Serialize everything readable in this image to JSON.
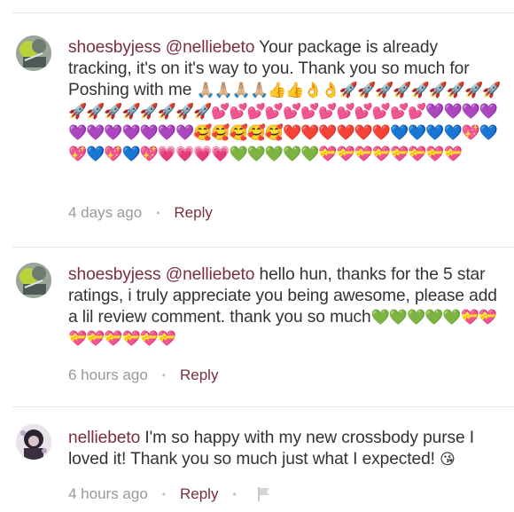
{
  "colors": {
    "username": "#7a2e3e",
    "body_text": "#333333",
    "meta_text": "#999999",
    "divider": "#e6e6e6"
  },
  "comments": [
    {
      "username": "shoesbyjess",
      "mention": "@nelliebeto",
      "text": "Your package is already tracking, it's on it's way to you. Thank you so much for Poshing with me",
      "emojis": "🙏🏼🙏🏼🙏🏼🙏🏼👍👍👌👌🚀🚀🚀🚀🚀🚀🚀🚀🚀🚀🚀🚀🚀🚀🚀🚀🚀💕💕💕💕💕💕💕💕💕💕💕💕💜💜💜💜💜💜💜💜💜💜💜🥰🥰🥰🥰🥰❤️❤️❤️❤️❤️❤️💙💙💙💙💖💙💖💙💖💙💖💗💗💗💗💚💚💚💚💚💝💝💝💝💝💝💝💝",
      "time": "4 days ago",
      "reply_label": "Reply",
      "avatar_icon": "profile-photo-icon"
    },
    {
      "username": "shoesbyjess",
      "mention": "@nelliebeto",
      "text": "hello hun, thanks for the 5 star ratings, i truly appreciate you being awesome, please add a lil review comment. thank you so much",
      "emojis": "💚💚💚💚💚💝💝💝💝💝💝💝💝",
      "time": "6 hours ago",
      "reply_label": "Reply",
      "avatar_icon": "profile-photo-icon"
    },
    {
      "username": "nelliebeto",
      "mention": "",
      "text": "I'm so happy with my new crossbody purse I loved it! Thank you so much just what I expected!",
      "emojis": "😘",
      "time": "4 hours ago",
      "reply_label": "Reply",
      "avatar_icon": "profile-photo-icon",
      "flag_icon": "flag-icon"
    }
  ]
}
